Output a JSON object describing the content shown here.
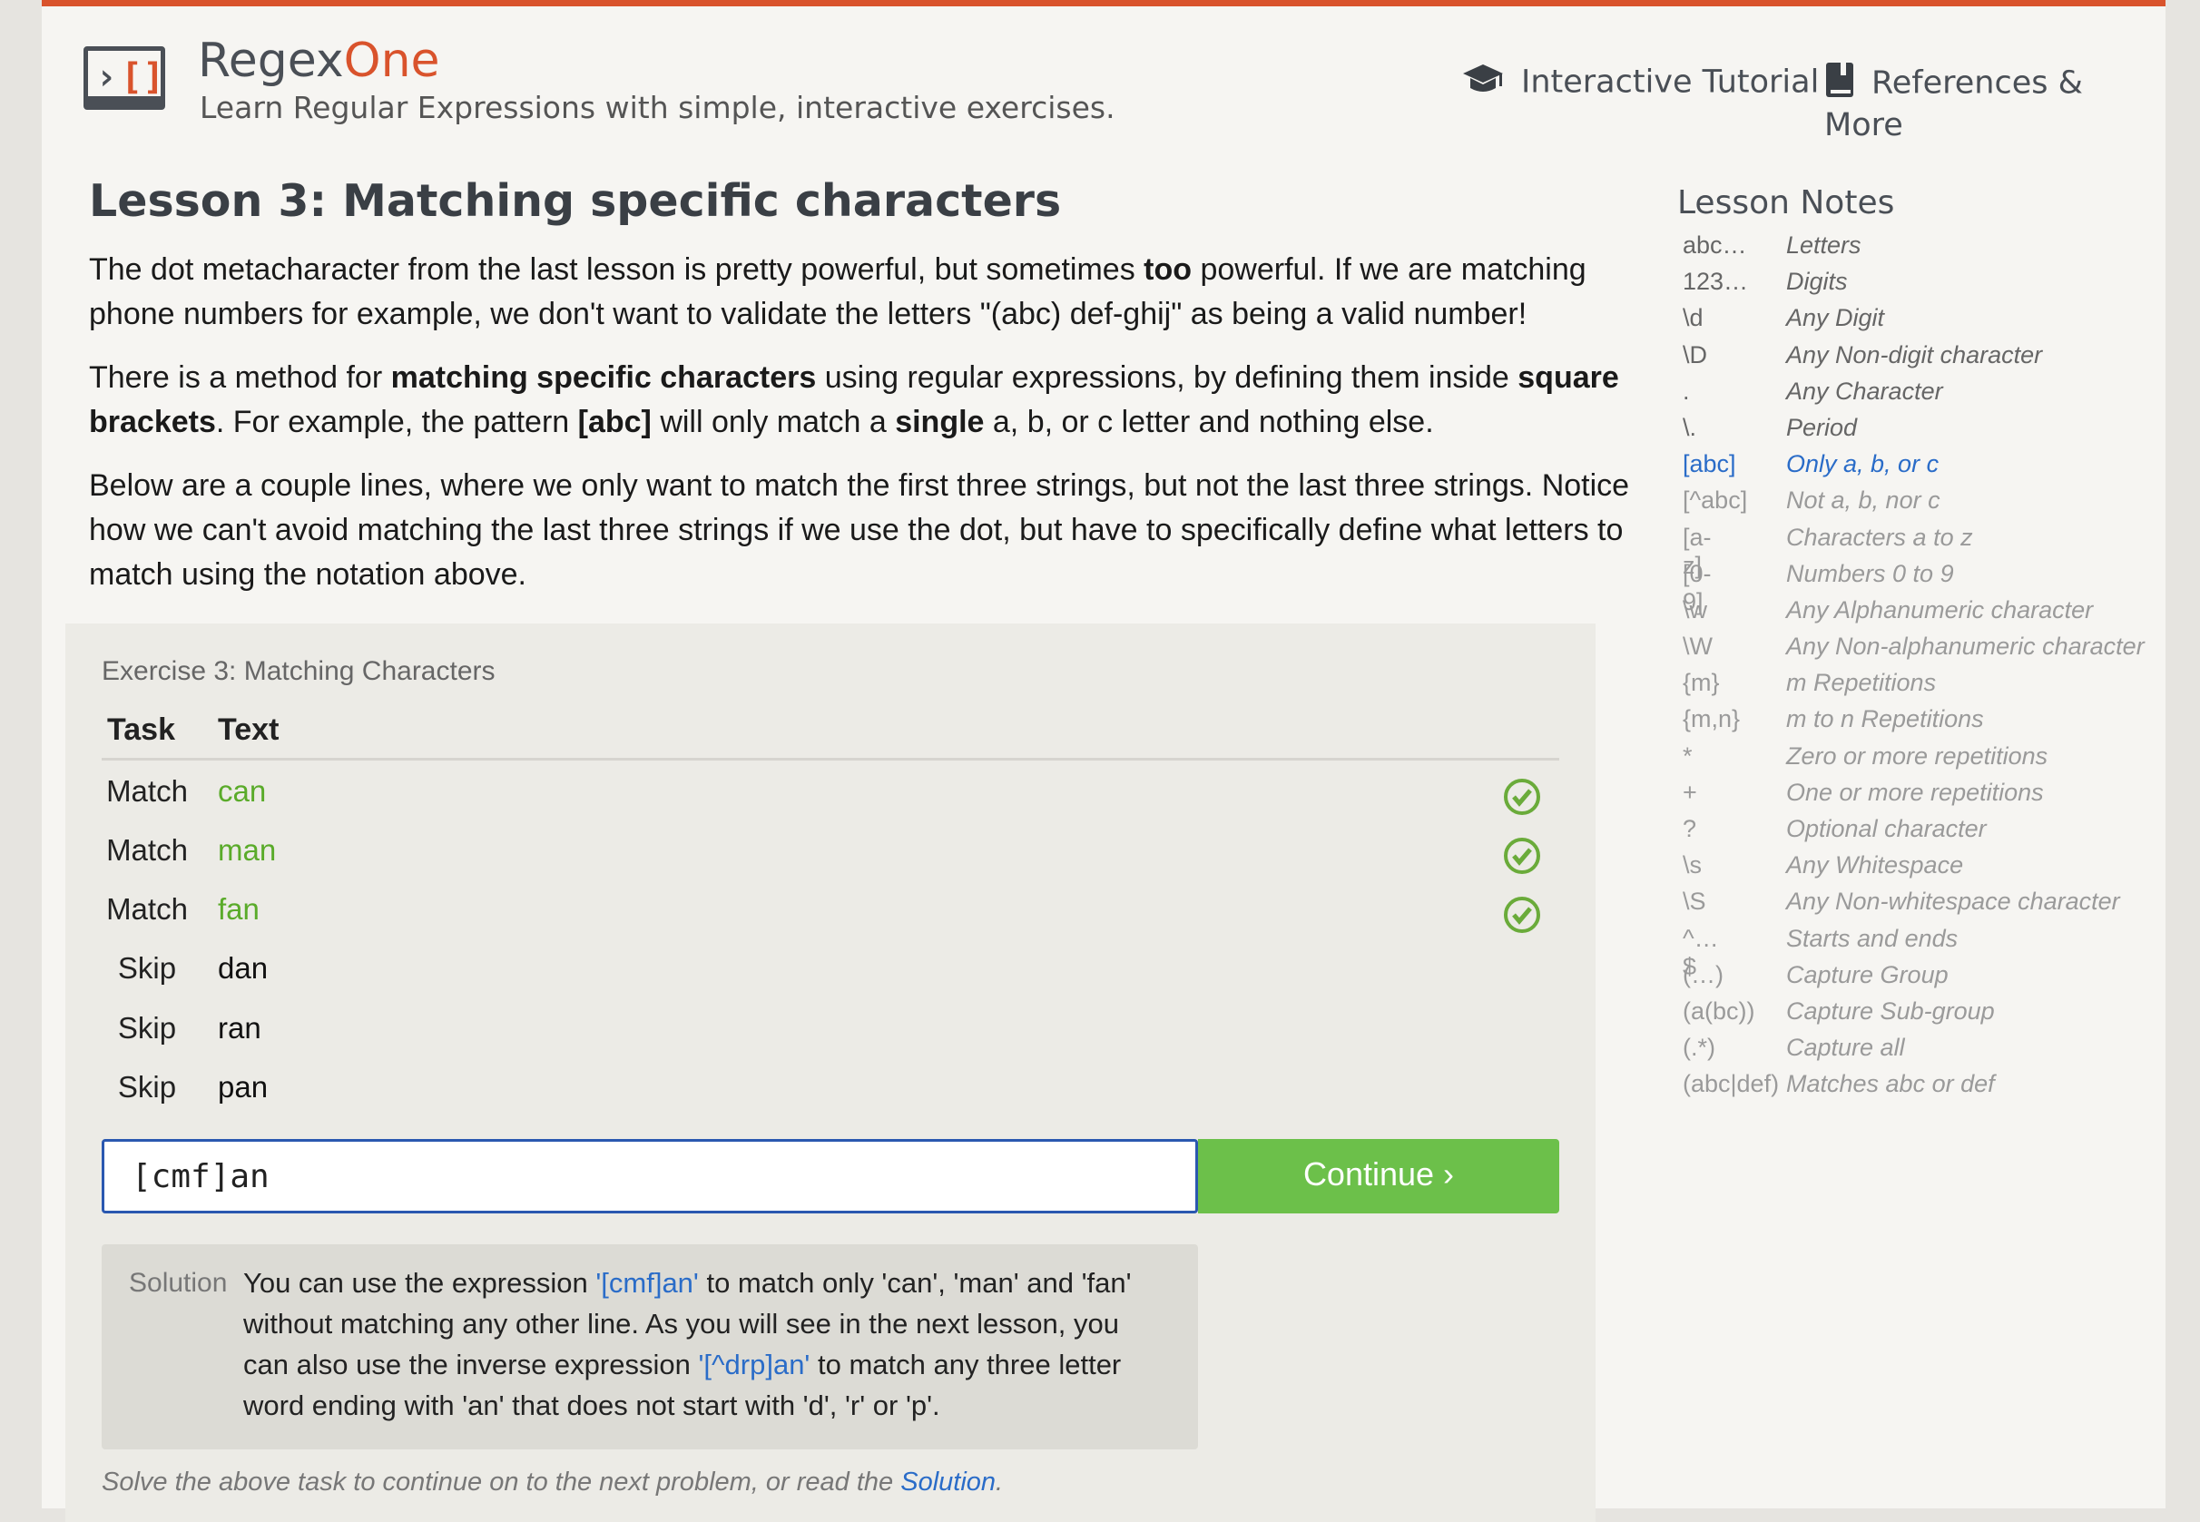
{
  "header": {
    "brand_prefix": "Regex",
    "brand_suffix": "One",
    "tagline": "Learn Regular Expressions with simple, interactive exercises.",
    "nav": [
      {
        "label": "Interactive Tutorial",
        "icon": "graduation-cap-icon"
      },
      {
        "label": "References & More",
        "icon": "book-icon"
      }
    ]
  },
  "lesson": {
    "title": "Lesson 3: Matching specific characters",
    "p1": {
      "a": "The dot metacharacter from the last lesson is pretty powerful, but sometimes ",
      "b": "too",
      "c": " powerful. If we are matching phone numbers for example, we don't want to validate the letters \"(abc) def-ghij\" as being a valid number!"
    },
    "p2": {
      "a": "There is a method for ",
      "b": "matching specific characters",
      "c": " using regular expressions, by defining them inside ",
      "d": "square brackets",
      "e": ". For example, the pattern ",
      "f": "[abc]",
      "g": " will only match a ",
      "h": "single",
      "i": " a, b, or c letter and nothing else."
    },
    "p3": "Below are a couple lines, where we only want to match the first three strings, but not the last three strings. Notice how we can't avoid matching the last three strings if we use the dot, but have to specifically define what letters to match using the notation above."
  },
  "exercise": {
    "title": "Exercise 3: Matching Characters",
    "col_task": "Task",
    "col_text": "Text",
    "rows": [
      {
        "task": "Match",
        "text": "can",
        "matched": true
      },
      {
        "task": "Match",
        "text": "man",
        "matched": true
      },
      {
        "task": "Match",
        "text": "fan",
        "matched": true
      },
      {
        "task": "Skip",
        "text": "dan",
        "matched": false
      },
      {
        "task": "Skip",
        "text": "ran",
        "matched": false
      },
      {
        "task": "Skip",
        "text": "pan",
        "matched": false
      }
    ],
    "input_value": "[cmf]an",
    "continue_label": "Continue ›",
    "solution_label": "Solution",
    "solution": {
      "a": "You can use the expression ",
      "b": "'[cmf]an'",
      "c": " to match only 'can', 'man' and 'fan' without matching any other line. As you will see in the next lesson, you can also use the inverse expression ",
      "d": "'[^drp]an'",
      "e": " to match any three letter word ending with 'an' that does not start with 'd', 'r' or 'p'."
    },
    "footnote_prefix": "Solve the above task to continue on to the next problem, or read the ",
    "footnote_link": "Solution",
    "footnote_suffix": "."
  },
  "notes": {
    "title": "Lesson Notes",
    "items": [
      {
        "sym": "abc…",
        "desc": "Letters",
        "state": "dark"
      },
      {
        "sym": "123…",
        "desc": "Digits",
        "state": "dark"
      },
      {
        "sym": "\\d",
        "desc": "Any Digit",
        "state": "dark"
      },
      {
        "sym": "\\D",
        "desc": "Any Non-digit character",
        "state": "dark"
      },
      {
        "sym": ".",
        "desc": "Any Character",
        "state": "dark"
      },
      {
        "sym": "\\.",
        "desc": "Period",
        "state": "dark"
      },
      {
        "sym": "[abc]",
        "desc": "Only a, b, or c",
        "state": "active"
      },
      {
        "sym": "[^abc]",
        "desc": "Not a, b, nor c",
        "state": "light"
      },
      {
        "sym": "[a-z]",
        "desc": "Characters a to z",
        "state": "light"
      },
      {
        "sym": "[0-9]",
        "desc": "Numbers 0 to 9",
        "state": "light"
      },
      {
        "sym": "\\w",
        "desc": "Any Alphanumeric character",
        "state": "light"
      },
      {
        "sym": "\\W",
        "desc": "Any Non-alphanumeric character",
        "state": "light"
      },
      {
        "sym": "{m}",
        "desc": "m Repetitions",
        "state": "light"
      },
      {
        "sym": "{m,n}",
        "desc": "m to n Repetitions",
        "state": "light"
      },
      {
        "sym": "*",
        "desc": "Zero or more repetitions",
        "state": "light"
      },
      {
        "sym": "+",
        "desc": "One or more repetitions",
        "state": "light"
      },
      {
        "sym": "?",
        "desc": "Optional character",
        "state": "light"
      },
      {
        "sym": "\\s",
        "desc": "Any Whitespace",
        "state": "light"
      },
      {
        "sym": "\\S",
        "desc": "Any Non-whitespace character",
        "state": "light"
      },
      {
        "sym": "^…$",
        "desc": "Starts and ends",
        "state": "light"
      },
      {
        "sym": "(…)",
        "desc": "Capture Group",
        "state": "light"
      },
      {
        "sym": "(a(bc))",
        "desc": "Capture Sub-group",
        "state": "light"
      },
      {
        "sym": "(.*)",
        "desc": "Capture all",
        "state": "light"
      },
      {
        "sym": "(abc|def)",
        "desc": "Matches abc or def",
        "state": "light"
      }
    ]
  },
  "colors": {
    "accent": "#d9532c",
    "match_green": "#5aab2a",
    "button_green": "#6cc04a",
    "link_blue": "#2a6cc8"
  }
}
